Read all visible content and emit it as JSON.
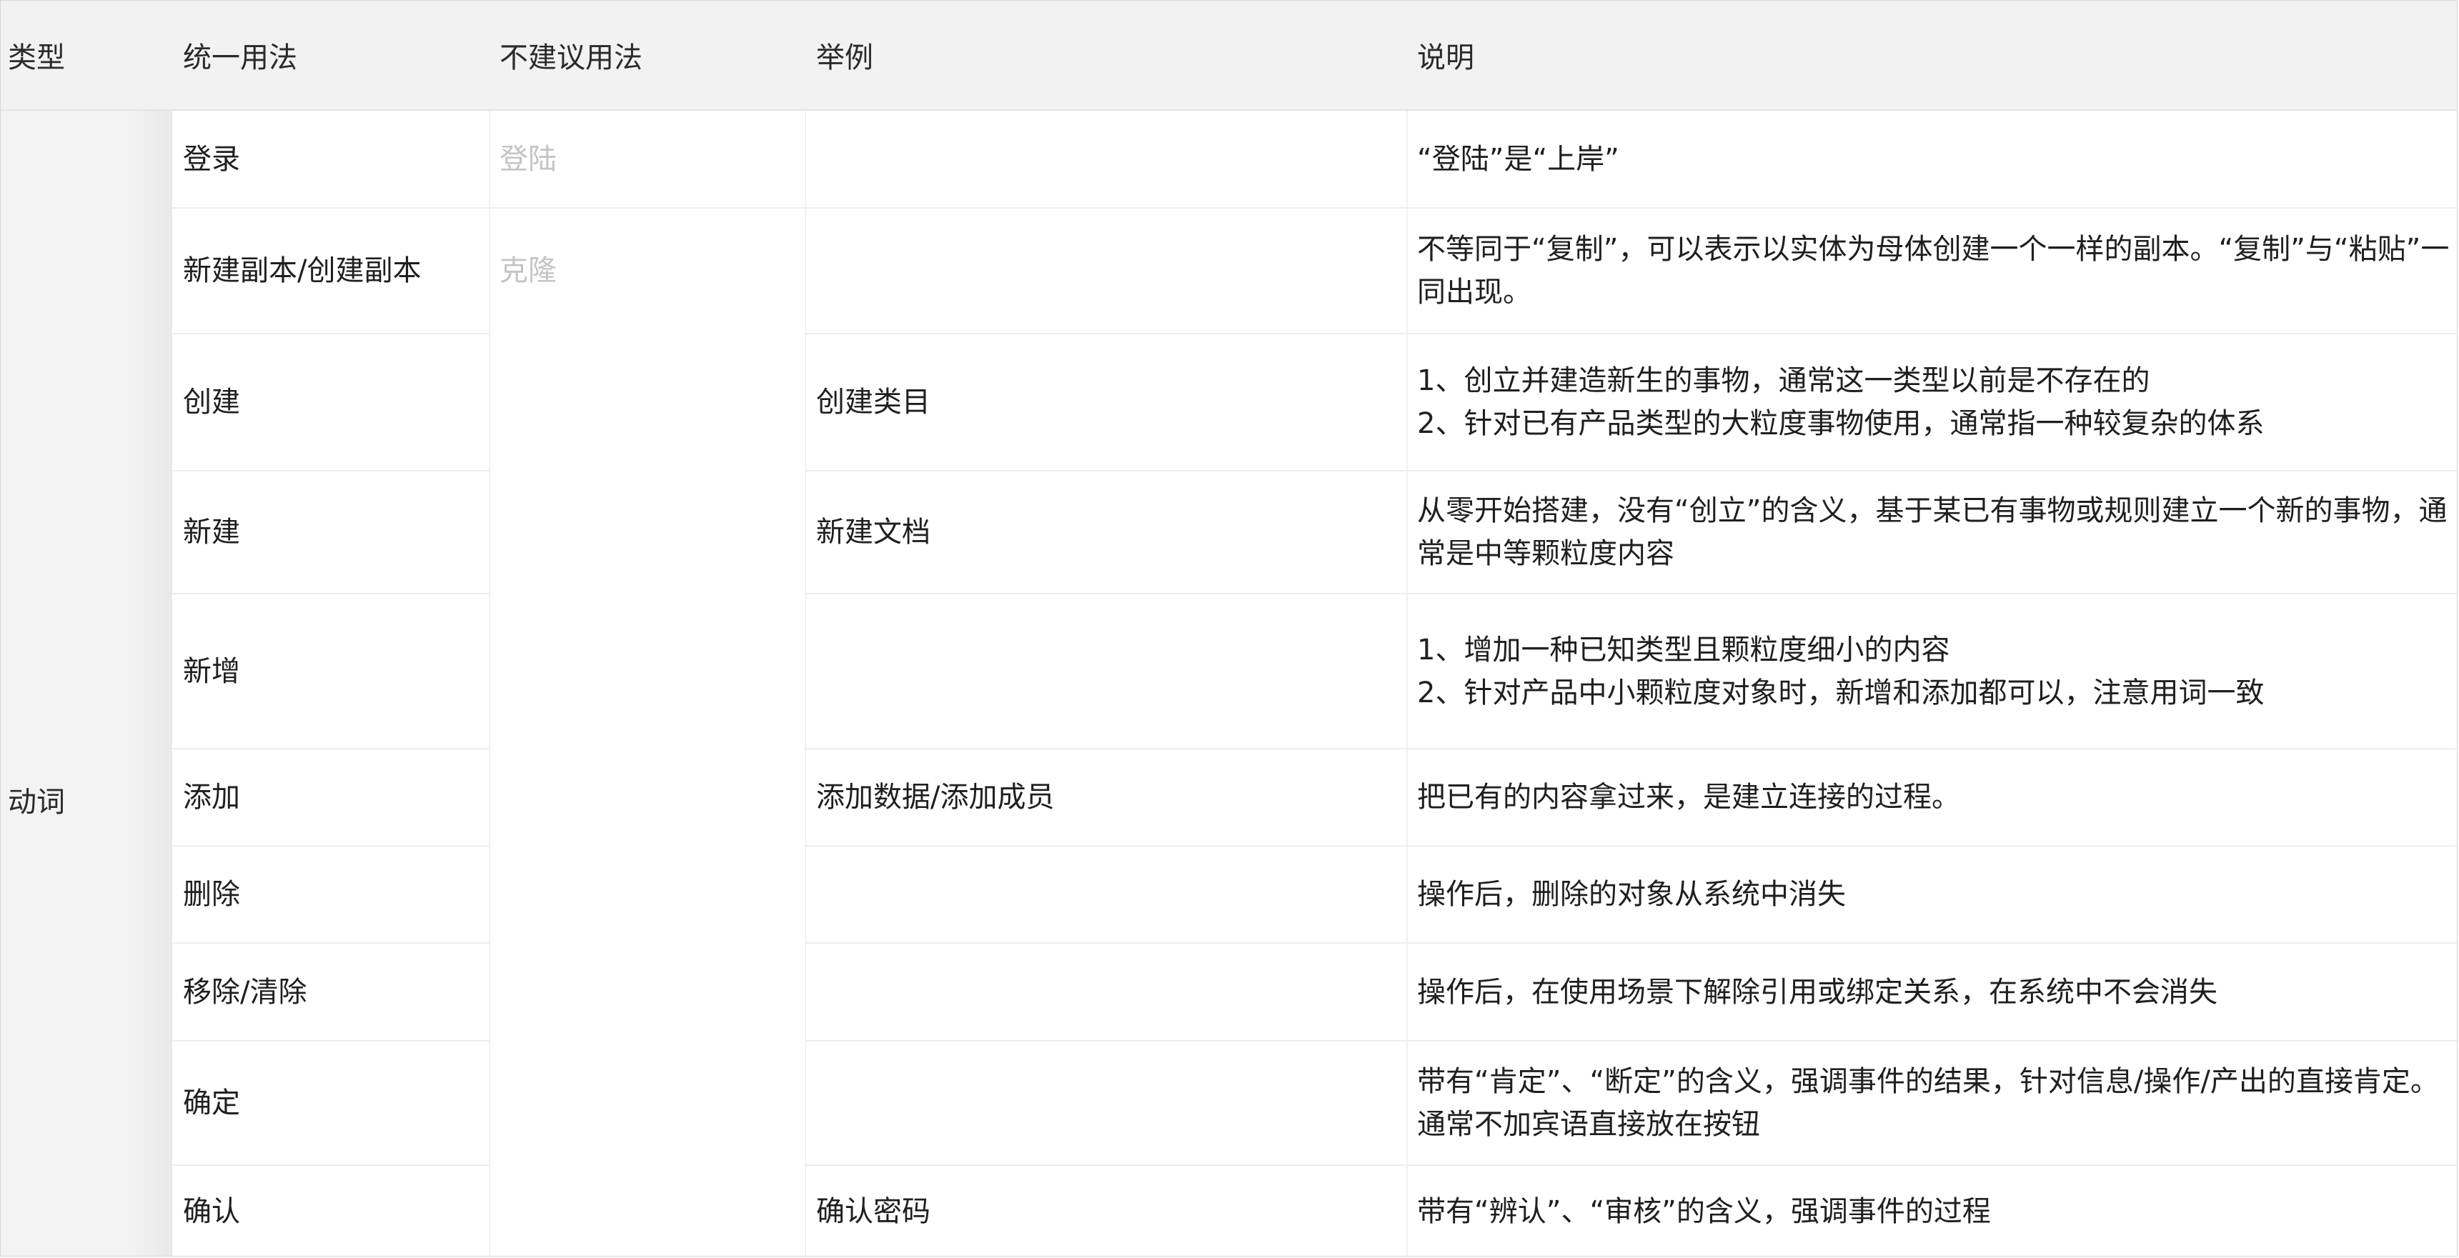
{
  "header": {
    "type": "类型",
    "unified": "统一用法",
    "not_recommended": "不建议用法",
    "example": "举例",
    "explanation": "说明"
  },
  "type_label": "动词",
  "rows": [
    {
      "unified": "登录",
      "not_recommended": "登陆",
      "example": "",
      "explanation": "“登陆”是“上岸”"
    },
    {
      "unified": "新建副本/创建副本",
      "not_recommended": "克隆",
      "example": "",
      "explanation": "不等同于“复制”，可以表示以实体为母体创建一个一样的副本。“复制”与“粘贴”一同出现。"
    },
    {
      "unified": "创建",
      "not_recommended": "",
      "example": "创建类目",
      "explanation": "1、创立并建造新生的事物，通常这一类型以前是不存在的\n2、针对已有产品类型的大粒度事物使用，通常指一种较复杂的体系"
    },
    {
      "unified": "新建",
      "not_recommended": "",
      "example": "新建文档",
      "explanation": "从零开始搭建，没有“创立”的含义，基于某已有事物或规则建立一个新的事物，通常是中等颗粒度内容"
    },
    {
      "unified": "新增",
      "not_recommended": "",
      "example": "",
      "explanation": "1、增加一种已知类型且颗粒度细小的内容\n2、针对产品中小颗粒度对象时，新增和添加都可以，注意用词一致"
    },
    {
      "unified": "添加",
      "not_recommended": "",
      "example": "添加数据/添加成员",
      "explanation": "把已有的内容拿过来，是建立连接的过程。"
    },
    {
      "unified": "删除",
      "not_recommended": "",
      "example": "",
      "explanation": "操作后，删除的对象从系统中消失"
    },
    {
      "unified": "移除/清除",
      "not_recommended": "",
      "example": "",
      "explanation": "操作后，在使用场景下解除引用或绑定关系，在系统中不会消失"
    },
    {
      "unified": "确定",
      "not_recommended": "",
      "example": "",
      "explanation": "带有“肯定”、“断定”的含义，强调事件的结果，针对信息/操作/产出的直接肯定。通常不加宾语直接放在按钮"
    },
    {
      "unified": "确认",
      "not_recommended": "",
      "example": "确认密码",
      "explanation": "带有“辨认”、“审核”的含义，强调事件的过程"
    }
  ]
}
